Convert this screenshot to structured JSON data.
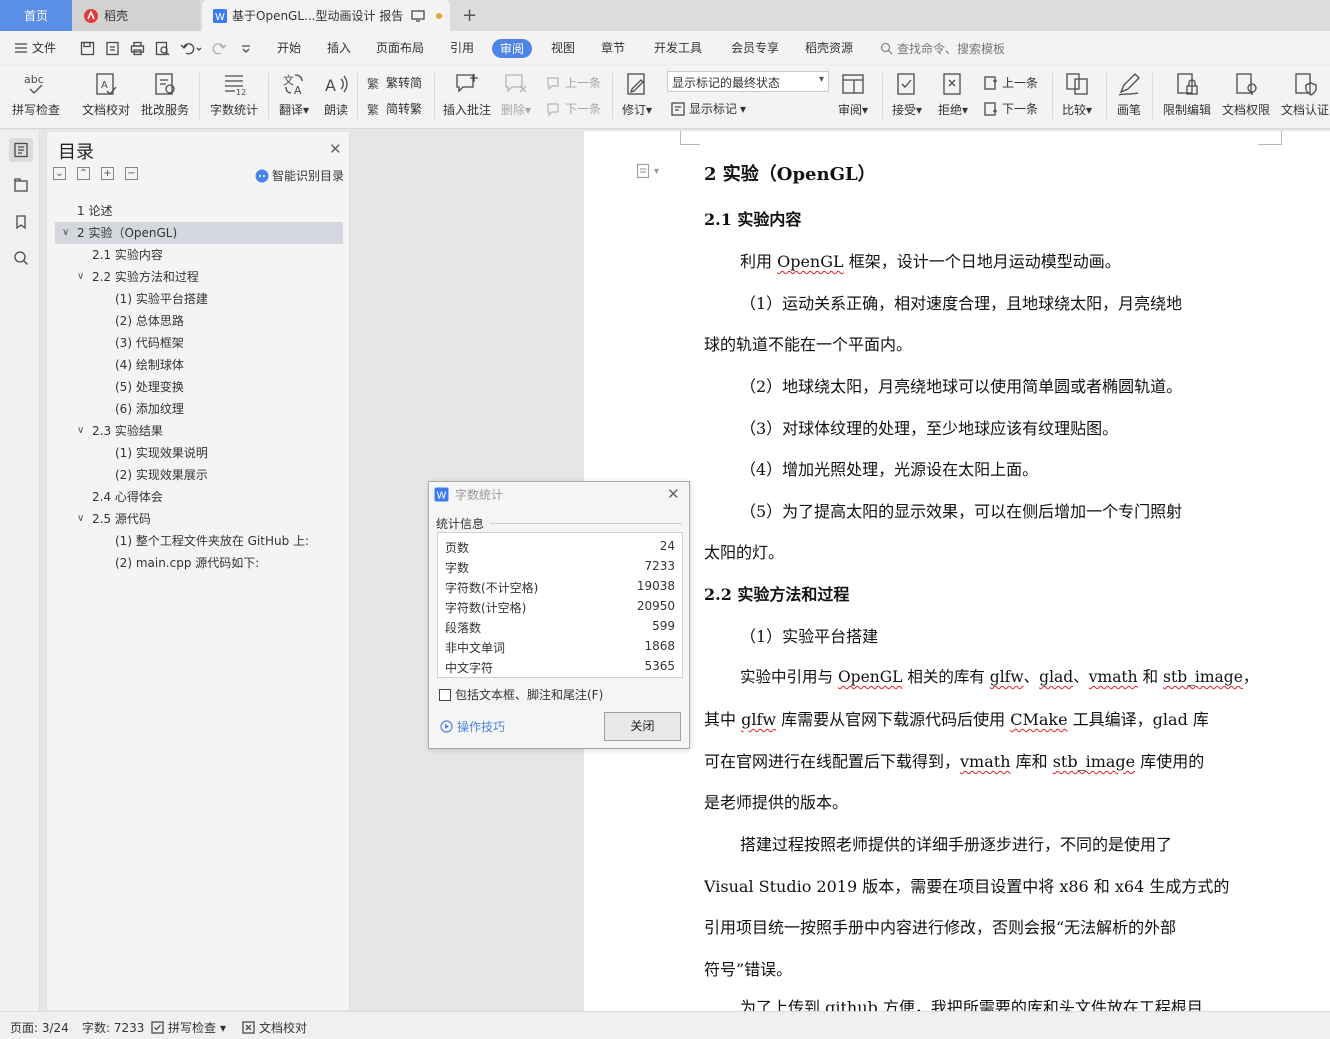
{
  "tabs": [
    {
      "label": "首页"
    },
    {
      "label": "稻壳"
    },
    {
      "label": "基于OpenGL...型动画设计 报告"
    }
  ],
  "menu": {
    "file": "文件",
    "items": [
      "开始",
      "插入",
      "页面布局",
      "引用",
      "审阅",
      "视图",
      "章节",
      "开发工具",
      "会员专享",
      "稻壳资源"
    ],
    "active_index": 4,
    "search_placeholder": "查找命令、搜索模板"
  },
  "ribbon": {
    "spell": "拼写检查",
    "proofread": "文档校对",
    "annotate_service": "批改服务",
    "word_count": "字数统计",
    "translate": "翻译",
    "read_aloud": "朗读",
    "trad_to_simp": "繁转简",
    "simp_to_trad": "简转繁",
    "insert_comment": "插入批注",
    "delete": "删除",
    "prev_comment": "上一条",
    "next_comment": "下一条",
    "track_changes": "修订",
    "display_mode": "显示标记的最终状态",
    "show_markup": "显示标记",
    "review": "审阅",
    "accept": "接受",
    "reject": "拒绝",
    "prev_change": "上一条",
    "next_change": "下一条",
    "compare": "比较",
    "ink": "画笔",
    "restrict_edit": "限制编辑",
    "doc_permission": "文档权限",
    "doc_auth": "文档认证"
  },
  "toc": {
    "title": "目录",
    "smart": "智能识别目录",
    "items": [
      {
        "text": "1  论述",
        "level": 1,
        "caret": ""
      },
      {
        "text": "2  实验（OpenGL)",
        "level": 1,
        "caret": "v",
        "selected": true
      },
      {
        "text": "2.1  实验内容",
        "level": 2,
        "caret": ""
      },
      {
        "text": "2.2  实验方法和过程",
        "level": 2,
        "caret": "v"
      },
      {
        "text": "(1)  实验平台搭建",
        "level": 3,
        "caret": ""
      },
      {
        "text": "(2)  总体思路",
        "level": 3,
        "caret": ""
      },
      {
        "text": "(3)  代码框架",
        "level": 3,
        "caret": ""
      },
      {
        "text": "(4)  绘制球体",
        "level": 3,
        "caret": ""
      },
      {
        "text": "(5)  处理变换",
        "level": 3,
        "caret": ""
      },
      {
        "text": "(6)  添加纹理",
        "level": 3,
        "caret": ""
      },
      {
        "text": "2.3  实验结果",
        "level": 2,
        "caret": "v"
      },
      {
        "text": "(1)  实现效果说明",
        "level": 3,
        "caret": ""
      },
      {
        "text": "(2)  实现效果展示",
        "level": 3,
        "caret": ""
      },
      {
        "text": "2.4  心得体会",
        "level": 2,
        "caret": ""
      },
      {
        "text": "2.5  源代码",
        "level": 2,
        "caret": "v"
      },
      {
        "text": "(1)  整个工程文件夹放在 GitHub 上:",
        "level": 3,
        "caret": ""
      },
      {
        "text": "(2)  main.cpp 源代码如下:",
        "level": 3,
        "caret": ""
      }
    ]
  },
  "doc": {
    "h1": "2  实验（OpenGL）",
    "h2a": "2.1  实验内容",
    "p1a": "利用 ",
    "p1b": "OpenGL",
    "p1c": " 框架，设计一个日地月运动模型动画。",
    "p2": "（1）运动关系正确，相对速度合理，且地球绕太阳，月亮绕地",
    "p2b": "球的轨道不能在一个平面内。",
    "p3": "（2）地球绕太阳，月亮绕地球可以使用简单圆或者椭圆轨道。",
    "p4": "（3）对球体纹理的处理，至少地球应该有纹理贴图。",
    "p5": "（4）增加光照处理，光源设在太阳上面。",
    "p6": "（5）为了提高太阳的显示效果，可以在侧后增加一个专门照射",
    "p6b": "太阳的灯。",
    "h2b": "2.2  实验方法和过程",
    "p7": "（1）实验平台搭建",
    "p8a": "实验中引用与 ",
    "p8b": "OpenGL",
    "p8c": " 相关的库有 ",
    "p8d": "glfw",
    "p8e": "、",
    "p8f": "glad",
    "p8g": "、",
    "p8h": "vmath",
    "p8i": " 和 ",
    "p8j": "stb_image",
    "p8k": "，",
    "p9a": "其中 ",
    "p9b": "glfw",
    "p9c": " 库需要从官网下载源代码后使用 ",
    "p9d": "CMake",
    "p9e": " 工具编译，glad 库",
    "p10a": "可在官网进行在线配置后下载得到，",
    "p10b": "vmath",
    "p10c": " 库和 ",
    "p10d": "stb_image",
    "p10e": " 库使用的",
    "p11": "是老师提供的版本。",
    "p12": "搭建过程按照老师提供的详细手册逐步进行，不同的是使用了",
    "p13": "Visual Studio 2019 版本，需要在项目设置中将 x86 和 x64 生成方式的",
    "p14": "引用项目统一按照手册中内容进行修改，否则会报“无法解析的外部",
    "p15": "符号”错误。",
    "p16a": "为了上传到 ",
    "p16b": "github",
    "p16c": " 方便，我把所需要的库和头文件放在工程根目"
  },
  "dialog": {
    "title": "字数统计",
    "section": "统计信息",
    "rows": [
      {
        "label": "页数",
        "value": "24"
      },
      {
        "label": "字数",
        "value": "7233"
      },
      {
        "label": "字符数(不计空格)",
        "value": "19038"
      },
      {
        "label": "字符数(计空格)",
        "value": "20950"
      },
      {
        "label": "段落数",
        "value": "599"
      },
      {
        "label": "非中文单词",
        "value": "1868"
      },
      {
        "label": "中文字符",
        "value": "5365"
      }
    ],
    "include": "包括文本框、脚注和尾注(F)",
    "tips": "操作技巧",
    "close": "关闭"
  },
  "status": {
    "page": "页面: 3/24",
    "words": "字数: 7233",
    "spell": "拼写检查",
    "proof": "文档校对"
  },
  "colors": {
    "accent": "#4d84e6",
    "home_tab": "#5b8ee6",
    "modified_dot": "#e4a23a"
  }
}
